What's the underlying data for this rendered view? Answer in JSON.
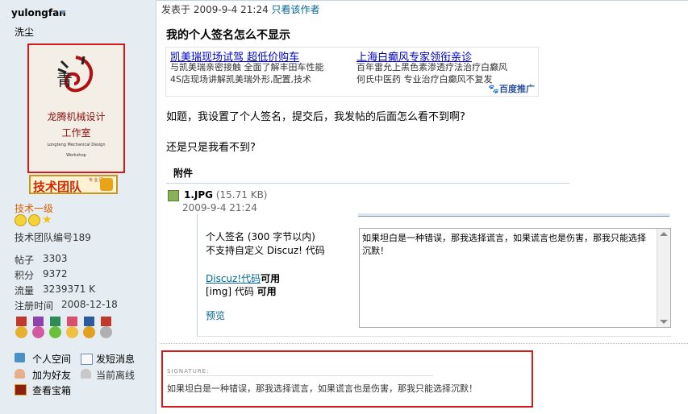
{
  "profile": {
    "username": "yulongfan",
    "nickname": "洗尘",
    "avatar": {
      "line1": "龙腾机械设计",
      "line2": "工作室",
      "line3": "Longteng Mechanical Design",
      "line4": "Workshop"
    },
    "team_badge": {
      "label": "技术团队",
      "small": "专 业 团"
    },
    "rank": "技术一级",
    "team_number": "技术团队编号189",
    "stats": [
      {
        "label": "帖子",
        "value": "3303"
      },
      {
        "label": "积分",
        "value": "9372"
      },
      {
        "label": "流量",
        "value": "3239371 K"
      },
      {
        "label": "注册时间",
        "value": "2008-12-18"
      }
    ],
    "actions": {
      "space": "个人空间",
      "message": "发短消息",
      "add_friend": "加为好友",
      "status": "当前离线",
      "treasure": "查看宝箱"
    }
  },
  "post": {
    "posted_prefix": "发表于",
    "posted_time": "2009-9-4 21:24",
    "only_author": "只看该作者",
    "title": "我的个人签名怎么不显示",
    "ads": [
      {
        "title": "凯美瑞现场试驾 超低价购车",
        "desc1": "与凯美瑞亲密接触 全面了解丰田车性能",
        "desc2": "4S店现场讲解凯美瑞外形,配置,技术"
      },
      {
        "title": "上海白癫风专家领衔亲诊",
        "desc1": "百年雷允上黑色素渗透疗法治疗白癫风",
        "desc2": "何氏中医药 专业治疗白癫风不复发"
      }
    ],
    "ad_brand": "百度推广",
    "body_line1": "如题，我设置了个人签名，提交后，我发帖的后面怎么看不到啊?",
    "body_line2": "还是只是我看不到?",
    "attachment_header": "附件",
    "attachment": {
      "name": "1.JPG",
      "size": "(15.71 KB)",
      "date": "2009-9-4 21:24"
    }
  },
  "sig_settings": {
    "label": "个人签名 (300 字节以内)",
    "no_custom": "不支持自定义 Discuz! 代码",
    "discuz_code": "Discuz!代码",
    "available": "可用",
    "img_code": "[img] 代码",
    "img_available": "可用",
    "preview": "预览",
    "textarea_value": "如果坦白是一种错误，那我选择谎言，如果谎言也是伤害，那我只能选择沉默！"
  },
  "signature": {
    "label": "SIGNATURE:",
    "text": "如果坦白是一种错误，那我选择谎言，如果谎言也是伤害，那我只能选择沉默！"
  },
  "colors": {
    "accent": "#006699",
    "highlight_border": "#d21b1b",
    "sidebar_bg": "#E5EDF2",
    "rank": "#e06000"
  }
}
